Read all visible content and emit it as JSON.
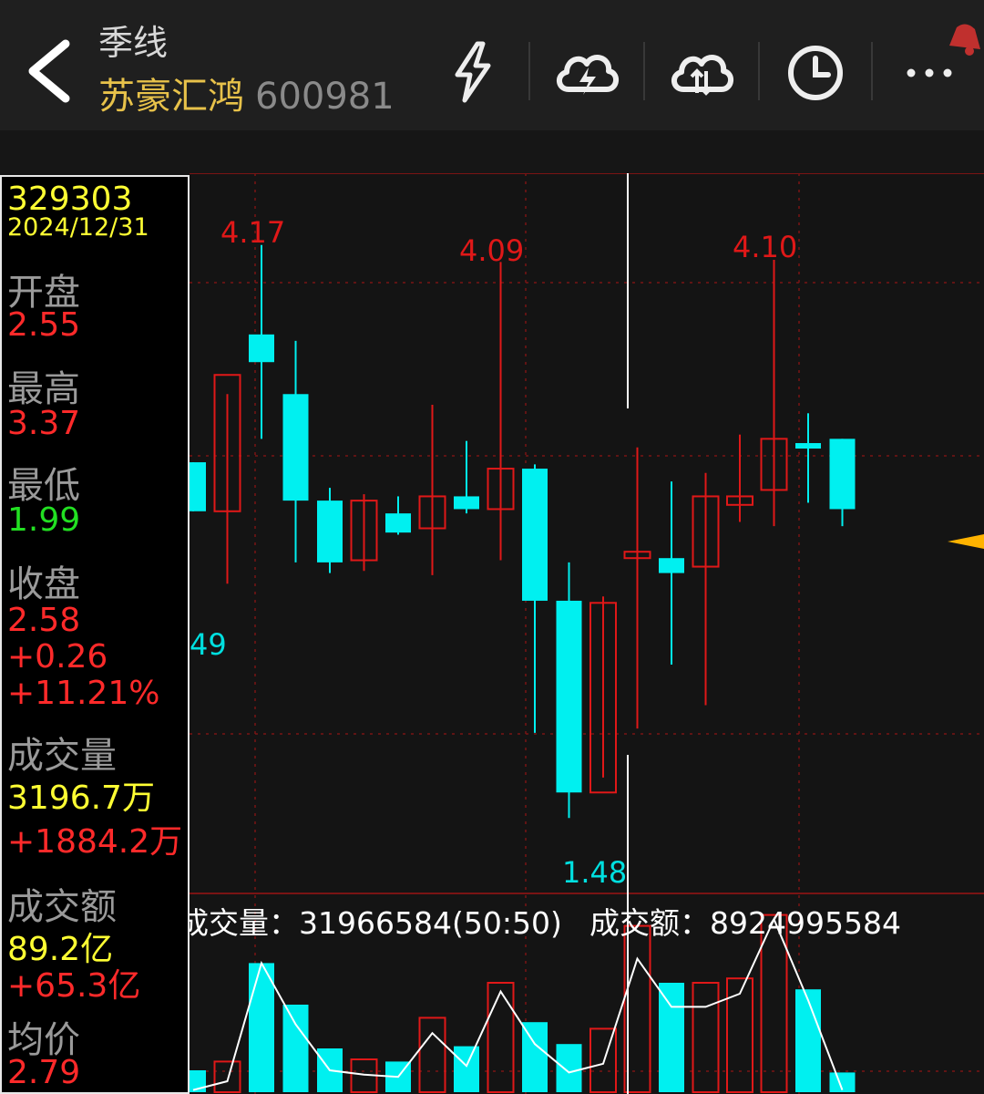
{
  "header": {
    "period": "季线",
    "stock_name": "苏豪汇鸿",
    "stock_code": "600981",
    "icons": [
      "back-arrow-icon",
      "lightning-icon",
      "cloud-lightning-icon",
      "cloud-sync-icon",
      "clock-icon",
      "more-icon",
      "bell-icon"
    ]
  },
  "info": {
    "id": "329303",
    "date": "2024/12/31",
    "open_label": "开盘",
    "open": "2.55",
    "high_label": "最高",
    "high": "3.37",
    "low_label": "最低",
    "low": "1.99",
    "close_label": "收盘",
    "close": "2.58",
    "change": "+0.26",
    "change_pct": "+11.21%",
    "volume_label": "成交量",
    "volume": "3196.7万",
    "volume_change": "+1884.2万",
    "amount_label": "成交额",
    "amount": "89.2亿",
    "amount_change": "+65.3亿",
    "avg_label": "均价",
    "avg": "2.79"
  },
  "chart_labels": {
    "max1": "4.17",
    "max2": "4.09",
    "max3": "4.10",
    "min": "1.48",
    "partial": "49",
    "vol_text": "成交量：31966584(50:50)",
    "amt_text": "成交额：8924995584"
  },
  "colors": {
    "up": "#e01818",
    "down": "#00f0f0",
    "bg": "#141414",
    "grid": "#7a1414",
    "avg_line": "#ffffff",
    "accent": "#ffb300"
  },
  "chart_data": {
    "type": "candlestick",
    "price_axis": "unlabeled",
    "candles": [
      {
        "dir": "down",
        "open": 3.15,
        "high": 3.15,
        "low": 2.92,
        "close": 2.92
      },
      {
        "dir": "up",
        "open": 2.92,
        "high": 3.47,
        "low": 2.58,
        "close": 3.56
      },
      {
        "dir": "down",
        "open": 3.75,
        "high": 4.17,
        "low": 3.26,
        "close": 3.62
      },
      {
        "dir": "down",
        "open": 3.47,
        "high": 3.72,
        "low": 2.68,
        "close": 2.97
      },
      {
        "dir": "down",
        "open": 2.97,
        "high": 3.03,
        "low": 2.63,
        "close": 2.68
      },
      {
        "dir": "up",
        "open": 2.69,
        "high": 3.0,
        "low": 2.64,
        "close": 2.97
      },
      {
        "dir": "down",
        "open": 2.91,
        "high": 2.99,
        "low": 2.81,
        "close": 2.82
      },
      {
        "dir": "up",
        "open": 2.84,
        "high": 3.42,
        "low": 2.62,
        "close": 2.99
      },
      {
        "dir": "down",
        "open": 2.99,
        "high": 3.25,
        "low": 2.91,
        "close": 2.93
      },
      {
        "dir": "up",
        "open": 2.93,
        "high": 4.09,
        "low": 2.69,
        "close": 3.12
      },
      {
        "dir": "down",
        "open": 3.12,
        "high": 3.14,
        "low": 1.88,
        "close": 2.5
      },
      {
        "dir": "down",
        "open": 2.5,
        "high": 2.68,
        "low": 1.48,
        "close": 1.6
      },
      {
        "dir": "up",
        "open": 1.6,
        "high": 2.52,
        "low": 1.67,
        "close": 2.49
      },
      {
        "dir": "up",
        "open": 2.7,
        "high": 3.22,
        "low": 1.9,
        "close": 2.73
      },
      {
        "dir": "down",
        "open": 2.7,
        "high": 3.06,
        "low": 2.2,
        "close": 2.63
      },
      {
        "dir": "up",
        "open": 2.66,
        "high": 3.1,
        "low": 2.01,
        "close": 2.99
      },
      {
        "dir": "up",
        "open": 2.95,
        "high": 3.28,
        "low": 2.87,
        "close": 2.99
      },
      {
        "dir": "up",
        "open": 3.02,
        "high": 4.1,
        "low": 2.85,
        "close": 3.26
      },
      {
        "dir": "down",
        "open": 3.24,
        "high": 3.38,
        "low": 2.96,
        "close": 3.22
      },
      {
        "dir": "down",
        "open": 3.26,
        "high": 3.26,
        "low": 2.85,
        "close": 2.93
      }
    ],
    "volume_bars": [
      {
        "dir": "down",
        "v": 0.1
      },
      {
        "dir": "up",
        "v": 0.14
      },
      {
        "dir": "down",
        "v": 0.59
      },
      {
        "dir": "down",
        "v": 0.4
      },
      {
        "dir": "down",
        "v": 0.2
      },
      {
        "dir": "up",
        "v": 0.15
      },
      {
        "dir": "down",
        "v": 0.14
      },
      {
        "dir": "up",
        "v": 0.34
      },
      {
        "dir": "down",
        "v": 0.21
      },
      {
        "dir": "up",
        "v": 0.5
      },
      {
        "dir": "down",
        "v": 0.32
      },
      {
        "dir": "down",
        "v": 0.22
      },
      {
        "dir": "up",
        "v": 0.29
      },
      {
        "dir": "up",
        "v": 0.76
      },
      {
        "dir": "down",
        "v": 0.5
      },
      {
        "dir": "up",
        "v": 0.5
      },
      {
        "dir": "up",
        "v": 0.52
      },
      {
        "dir": "up",
        "v": 0.81
      },
      {
        "dir": "down",
        "v": 0.47
      },
      {
        "dir": "down",
        "v": 0.09
      }
    ],
    "avg_line": [
      0.01,
      0.05,
      0.59,
      0.31,
      0.1,
      0.08,
      0.07,
      0.27,
      0.12,
      0.46,
      0.22,
      0.09,
      0.13,
      0.61,
      0.39,
      0.39,
      0.45,
      0.79,
      0.42,
      0.01
    ]
  }
}
